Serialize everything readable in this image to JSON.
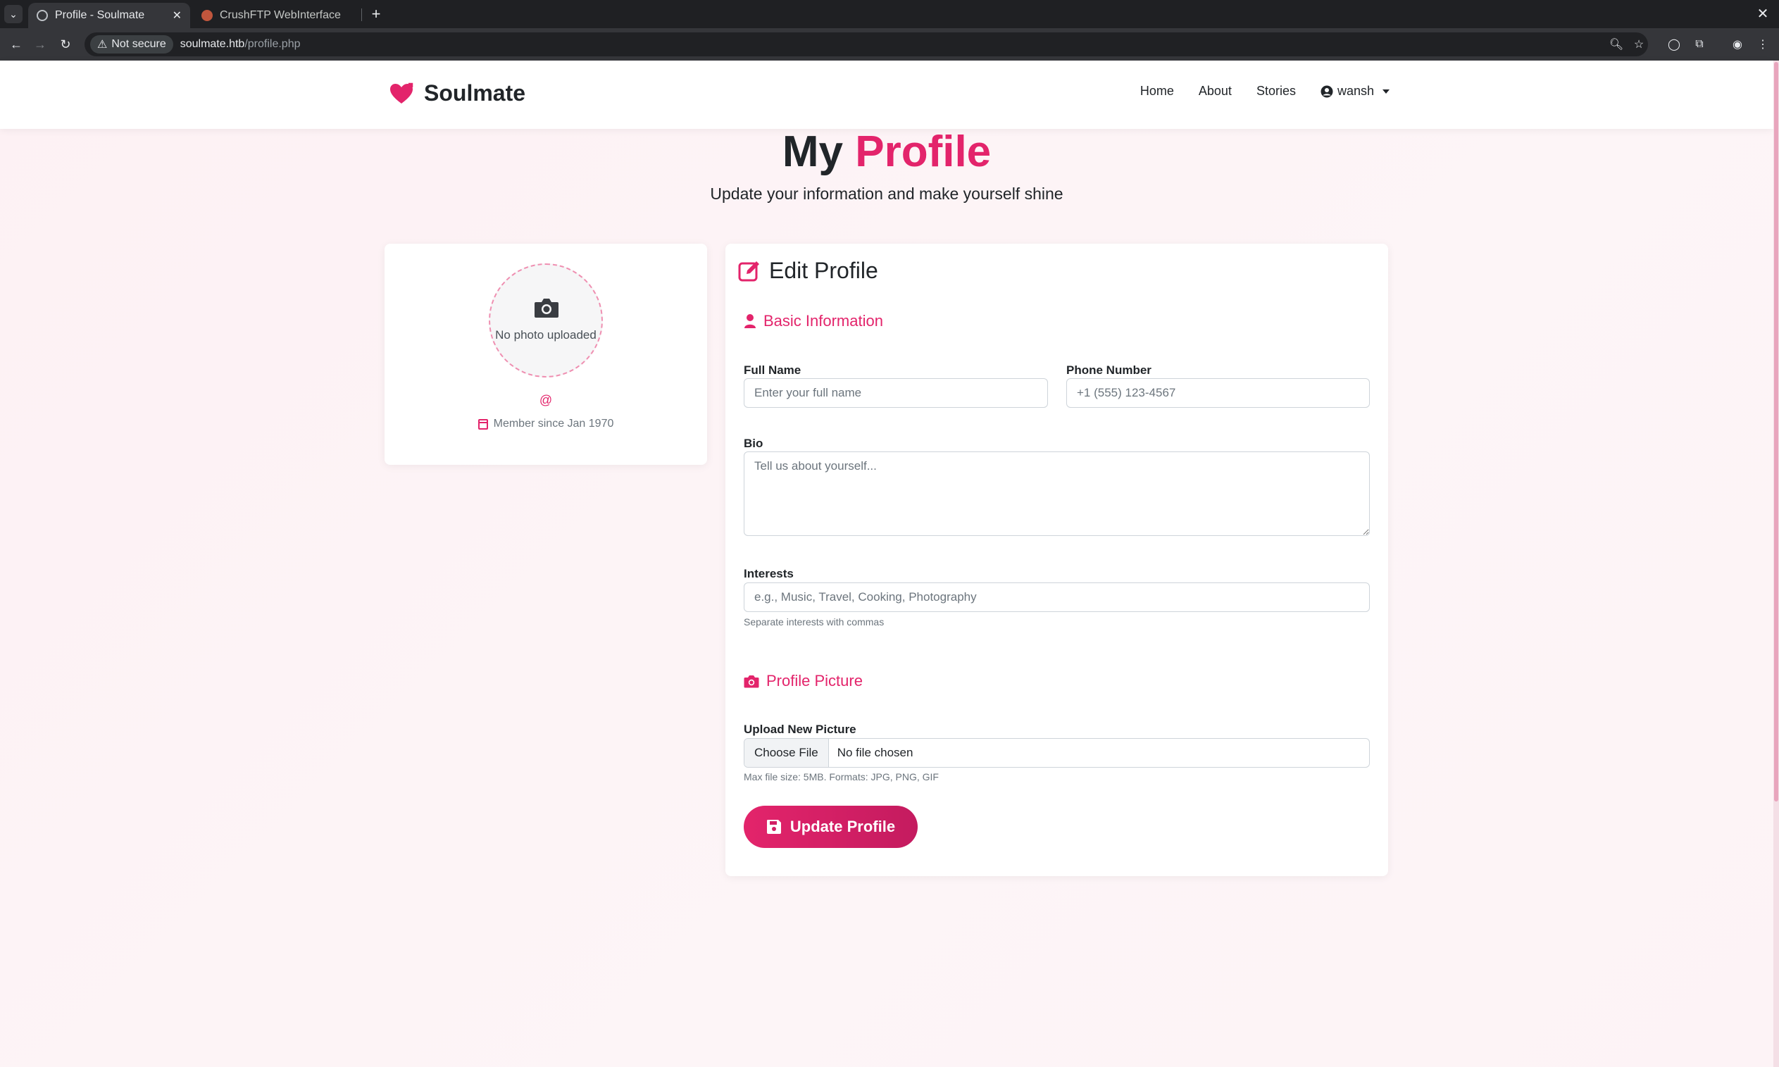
{
  "browser": {
    "tabs": [
      {
        "title": "Profile - Soulmate",
        "active": true
      },
      {
        "title": "CrushFTP WebInterface",
        "active": false
      }
    ],
    "new_tab_label": "+",
    "security_label": "Not secure",
    "url_host": "soulmate.htb",
    "url_path": "/profile.php"
  },
  "navbar": {
    "brand": "Soulmate",
    "links": [
      "Home",
      "About",
      "Stories"
    ],
    "user": "wansh"
  },
  "hero": {
    "title_plain": "My",
    "title_accent": "Profile",
    "subtitle": "Update your information and make yourself shine"
  },
  "profile_card": {
    "photo_text": "No photo uploaded",
    "username": "@",
    "member_since": "Member since Jan 1970"
  },
  "form": {
    "title": "Edit Profile",
    "basic_section": "Basic Information",
    "full_name": {
      "label": "Full Name",
      "placeholder": "Enter your full name",
      "value": ""
    },
    "phone": {
      "label": "Phone Number",
      "placeholder": "+1 (555) 123-4567",
      "value": ""
    },
    "bio": {
      "label": "Bio",
      "placeholder": "Tell us about yourself...",
      "value": ""
    },
    "interests": {
      "label": "Interests",
      "placeholder": "e.g., Music, Travel, Cooking, Photography",
      "help": "Separate interests with commas"
    },
    "picture_section": "Profile Picture",
    "upload": {
      "label": "Upload New Picture",
      "button": "Choose File",
      "status": "No file chosen",
      "help": "Max file size: 5MB. Formats: JPG, PNG, GIF"
    },
    "submit": "Update Profile"
  },
  "colors": {
    "accent": "#e3246b",
    "background": "#fdf3f6"
  }
}
